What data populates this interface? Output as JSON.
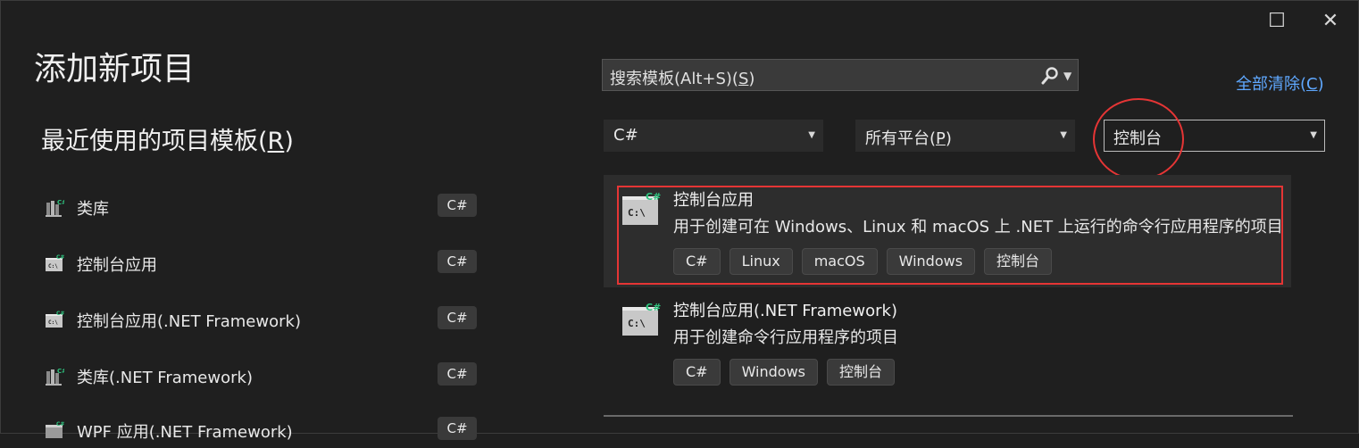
{
  "window": {
    "maximize_glyph": "☐",
    "close_glyph": "✕"
  },
  "page": {
    "title": "添加新项目"
  },
  "recent": {
    "title_pre": "最近使用的项目模板(",
    "title_key": "R",
    "title_post": ")",
    "items": [
      {
        "label": "类库",
        "tag": "C#",
        "icon": "class-library-icon"
      },
      {
        "label": "控制台应用",
        "tag": "C#",
        "icon": "console-app-icon"
      },
      {
        "label": "控制台应用(.NET Framework)",
        "tag": "C#",
        "icon": "console-app-icon"
      },
      {
        "label": "类库(.NET Framework)",
        "tag": "C#",
        "icon": "class-library-icon"
      },
      {
        "label": "WPF 应用(.NET Framework)",
        "tag": "C#",
        "icon": "wpf-app-icon"
      }
    ]
  },
  "search": {
    "placeholder_pre": "搜索模板(Alt+S)(",
    "placeholder_key": "S",
    "placeholder_post": ")"
  },
  "clear_all": {
    "pre": "全部清除(",
    "key": "C",
    "post": ")"
  },
  "filters": {
    "language": "C#",
    "platform_pre": "所有平台(",
    "platform_key": "P",
    "platform_post": ")",
    "project_type": "控制台"
  },
  "templates": [
    {
      "name": "控制台应用",
      "description": "用于创建可在 Windows、Linux 和 macOS 上 .NET 上运行的命令行应用程序的项目",
      "tags": [
        "C#",
        "Linux",
        "macOS",
        "Windows",
        "控制台"
      ],
      "selected": true
    },
    {
      "name": "控制台应用(.NET Framework)",
      "description": "用于创建命令行应用程序的项目",
      "tags": [
        "C#",
        "Windows",
        "控制台"
      ],
      "selected": false
    }
  ],
  "colors": {
    "accent_link": "#5fa8ff",
    "highlight": "#e53535",
    "csharp_green": "#2ec27e",
    "background": "#1f1f1f"
  }
}
